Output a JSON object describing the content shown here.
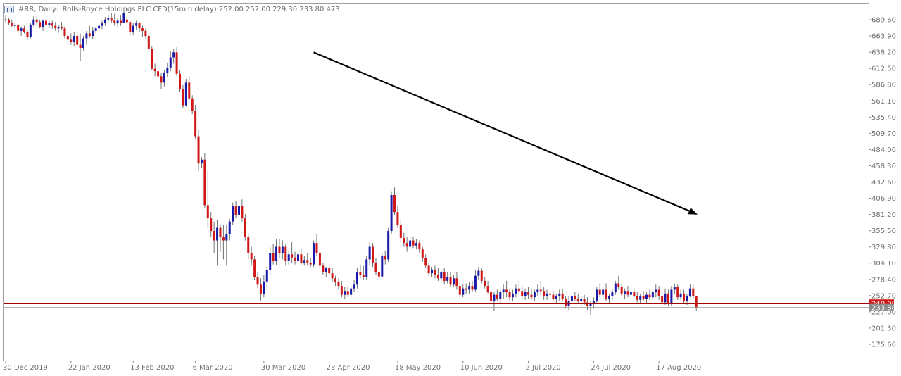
{
  "header": {
    "symbol": "#RR, Daily:",
    "name": "Rolls-Royce Holdings PLC CFD(15min delay)",
    "ohlc": "252.00 252.00 229.30 233.80",
    "volume": "473"
  },
  "colors": {
    "up": "#1a1aa8",
    "down": "#d01818",
    "level_line": "#a00000",
    "price_line": "#9a9a9a",
    "trend_arrow": "#000000",
    "grid_border": "#a0a0a0"
  },
  "chart_data": {
    "type": "candlestick",
    "y_ticks": [
      "689.60",
      "663.90",
      "638.20",
      "612.50",
      "586.80",
      "561.10",
      "535.40",
      "509.70",
      "484.00",
      "458.30",
      "432.60",
      "406.90",
      "381.20",
      "355.50",
      "329.80",
      "304.10",
      "278.40",
      "252.70",
      "227.00",
      "201.30",
      "175.60"
    ],
    "y_range": [
      149.9,
      715.3
    ],
    "x_labels": [
      "30 Dec 2019",
      "22 Jan 2020",
      "13 Feb 2020",
      "6 Mar 2020",
      "30 Mar 2020",
      "23 Apr 2020",
      "18 May 2020",
      "10 Jun 2020",
      "2 Jul 2020",
      "24 Jul 2020",
      "17 Aug 2020"
    ],
    "level_line": {
      "value": 240.0,
      "label": "240.00"
    },
    "current_price": {
      "value": 233.8,
      "label": "233.80"
    },
    "trend_arrow": {
      "from_candle": 99,
      "from_price": 638,
      "to_candle": 222,
      "to_price": 382
    },
    "candles": [
      [
        690,
        696,
        686,
        690
      ],
      [
        690,
        692,
        681,
        684
      ],
      [
        684,
        690,
        678,
        680
      ],
      [
        680,
        684,
        676,
        681
      ],
      [
        681,
        684,
        670,
        672
      ],
      [
        672,
        679,
        664,
        676
      ],
      [
        676,
        680,
        668,
        670
      ],
      [
        670,
        674,
        658,
        662
      ],
      [
        662,
        684,
        660,
        682
      ],
      [
        682,
        695,
        679,
        690
      ],
      [
        690,
        695,
        680,
        686
      ],
      [
        686,
        690,
        676,
        678
      ],
      [
        678,
        690,
        672,
        688
      ],
      [
        688,
        692,
        678,
        681
      ],
      [
        681,
        688,
        676,
        684
      ],
      [
        684,
        688,
        675,
        680
      ],
      [
        680,
        686,
        672,
        676
      ],
      [
        676,
        682,
        669,
        678
      ],
      [
        678,
        686,
        673,
        676
      ],
      [
        676,
        679,
        660,
        664
      ],
      [
        664,
        670,
        652,
        658
      ],
      [
        658,
        668,
        650,
        654
      ],
      [
        654,
        670,
        648,
        664
      ],
      [
        664,
        670,
        647,
        650
      ],
      [
        650,
        668,
        625,
        645
      ],
      [
        645,
        664,
        641,
        660
      ],
      [
        660,
        672,
        650,
        668
      ],
      [
        668,
        680,
        661,
        664
      ],
      [
        664,
        678,
        659,
        672
      ],
      [
        672,
        678,
        668,
        676
      ],
      [
        676,
        684,
        670,
        680
      ],
      [
        680,
        688,
        675,
        684
      ],
      [
        684,
        694,
        680,
        690
      ],
      [
        690,
        697,
        687,
        693
      ],
      [
        693,
        700,
        684,
        688
      ],
      [
        688,
        699,
        680,
        684
      ],
      [
        684,
        692,
        678,
        688
      ],
      [
        688,
        696,
        680,
        685
      ],
      [
        685,
        703,
        685,
        700
      ],
      [
        690,
        696,
        684,
        686
      ],
      [
        686,
        688,
        666,
        670
      ],
      [
        670,
        684,
        666,
        680
      ],
      [
        680,
        688,
        674,
        684
      ],
      [
        684,
        686,
        670,
        676
      ],
      [
        676,
        680,
        662,
        672
      ],
      [
        672,
        676,
        660,
        664
      ],
      [
        664,
        668,
        640,
        644
      ],
      [
        644,
        648,
        610,
        612
      ],
      [
        612,
        620,
        600,
        608
      ],
      [
        608,
        614,
        596,
        600
      ],
      [
        600,
        606,
        580,
        590
      ],
      [
        590,
        610,
        584,
        606
      ],
      [
        606,
        622,
        598,
        614
      ],
      [
        614,
        640,
        608,
        630
      ],
      [
        630,
        644,
        620,
        638
      ],
      [
        638,
        646,
        600,
        604
      ],
      [
        604,
        610,
        575,
        580
      ],
      [
        580,
        586,
        550,
        554
      ],
      [
        554,
        596,
        552,
        590
      ],
      [
        590,
        600,
        560,
        565
      ],
      [
        565,
        570,
        540,
        545
      ],
      [
        545,
        555,
        500,
        505
      ],
      [
        505,
        515,
        450,
        462
      ],
      [
        462,
        472,
        455,
        468
      ],
      [
        468,
        478,
        392,
        396
      ],
      [
        396,
        450,
        360,
        375
      ],
      [
        375,
        385,
        345,
        355
      ],
      [
        355,
        370,
        320,
        340
      ],
      [
        340,
        372,
        300,
        360
      ],
      [
        360,
        365,
        322,
        345
      ],
      [
        345,
        364,
        310,
        340
      ],
      [
        340,
        365,
        300,
        350
      ],
      [
        350,
        374,
        340,
        370
      ],
      [
        370,
        400,
        365,
        394
      ],
      [
        394,
        402,
        375,
        380
      ],
      [
        380,
        400,
        375,
        395
      ],
      [
        395,
        405,
        370,
        375
      ],
      [
        375,
        382,
        340,
        345
      ],
      [
        345,
        350,
        310,
        320
      ],
      [
        320,
        330,
        300,
        310
      ],
      [
        310,
        316,
        278,
        282
      ],
      [
        282,
        290,
        265,
        270
      ],
      [
        270,
        280,
        245,
        255
      ],
      [
        255,
        285,
        250,
        275
      ],
      [
        275,
        300,
        262,
        293
      ],
      [
        293,
        330,
        285,
        320
      ],
      [
        320,
        335,
        302,
        308
      ],
      [
        308,
        342,
        301,
        330
      ],
      [
        330,
        342,
        313,
        320
      ],
      [
        320,
        340,
        310,
        330
      ],
      [
        330,
        335,
        300,
        308
      ],
      [
        308,
        324,
        300,
        318
      ],
      [
        318,
        337,
        304,
        313
      ],
      [
        313,
        322,
        302,
        308
      ],
      [
        308,
        324,
        300,
        318
      ],
      [
        318,
        327,
        302,
        305
      ],
      [
        305,
        316,
        300,
        309
      ],
      [
        309,
        320,
        300,
        305
      ],
      [
        305,
        312,
        298,
        302
      ],
      [
        302,
        340,
        298,
        336
      ],
      [
        336,
        350,
        315,
        320
      ],
      [
        320,
        328,
        295,
        300
      ],
      [
        300,
        305,
        285,
        290
      ],
      [
        290,
        298,
        282,
        296
      ],
      [
        296,
        302,
        284,
        288
      ],
      [
        288,
        296,
        275,
        280
      ],
      [
        280,
        284,
        268,
        274
      ],
      [
        274,
        280,
        262,
        268
      ],
      [
        268,
        276,
        250,
        254
      ],
      [
        254,
        266,
        248,
        260
      ],
      [
        260,
        268,
        250,
        254
      ],
      [
        254,
        270,
        250,
        264
      ],
      [
        264,
        278,
        258,
        270
      ],
      [
        270,
        296,
        264,
        290
      ],
      [
        290,
        302,
        280,
        286
      ],
      [
        286,
        300,
        278,
        282
      ],
      [
        282,
        315,
        278,
        310
      ],
      [
        310,
        338,
        300,
        330
      ],
      [
        330,
        336,
        298,
        304
      ],
      [
        304,
        312,
        285,
        290
      ],
      [
        290,
        300,
        278,
        283
      ],
      [
        283,
        320,
        282,
        316
      ],
      [
        316,
        324,
        302,
        310
      ],
      [
        310,
        360,
        306,
        355
      ],
      [
        355,
        418,
        350,
        412
      ],
      [
        412,
        424,
        380,
        385
      ],
      [
        385,
        395,
        360,
        365
      ],
      [
        365,
        372,
        338,
        344
      ],
      [
        344,
        352,
        330,
        336
      ],
      [
        336,
        346,
        322,
        330
      ],
      [
        330,
        346,
        324,
        340
      ],
      [
        340,
        346,
        328,
        332
      ],
      [
        332,
        342,
        326,
        336
      ],
      [
        336,
        340,
        320,
        326
      ],
      [
        326,
        330,
        306,
        312
      ],
      [
        312,
        318,
        296,
        300
      ],
      [
        300,
        304,
        284,
        288
      ],
      [
        288,
        298,
        282,
        294
      ],
      [
        294,
        300,
        280,
        286
      ],
      [
        286,
        296,
        276,
        280
      ],
      [
        280,
        294,
        276,
        290
      ],
      [
        290,
        296,
        270,
        276
      ],
      [
        276,
        290,
        272,
        282
      ],
      [
        282,
        290,
        266,
        270
      ],
      [
        270,
        286,
        266,
        280
      ],
      [
        280,
        290,
        262,
        268
      ],
      [
        268,
        274,
        250,
        254
      ],
      [
        254,
        270,
        250,
        264
      ],
      [
        264,
        272,
        256,
        262
      ],
      [
        262,
        274,
        256,
        268
      ],
      [
        268,
        276,
        258,
        262
      ],
      [
        262,
        294,
        258,
        284
      ],
      [
        284,
        298,
        278,
        292
      ],
      [
        292,
        296,
        272,
        276
      ],
      [
        276,
        282,
        264,
        268
      ],
      [
        268,
        276,
        256,
        258
      ],
      [
        258,
        264,
        238,
        244
      ],
      [
        244,
        258,
        228,
        254
      ],
      [
        254,
        262,
        244,
        248
      ],
      [
        248,
        262,
        240,
        258
      ],
      [
        258,
        270,
        248,
        262
      ],
      [
        262,
        276,
        250,
        258
      ],
      [
        258,
        264,
        244,
        250
      ],
      [
        250,
        262,
        244,
        256
      ],
      [
        256,
        270,
        250,
        264
      ],
      [
        264,
        276,
        256,
        260
      ],
      [
        260,
        268,
        246,
        252
      ],
      [
        252,
        264,
        246,
        258
      ],
      [
        258,
        266,
        248,
        254
      ],
      [
        254,
        264,
        246,
        250
      ],
      [
        250,
        262,
        244,
        258
      ],
      [
        258,
        270,
        252,
        262
      ],
      [
        262,
        276,
        254,
        260
      ],
      [
        260,
        266,
        246,
        252
      ],
      [
        252,
        262,
        246,
        256
      ],
      [
        256,
        264,
        248,
        254
      ],
      [
        254,
        260,
        244,
        248
      ],
      [
        248,
        256,
        240,
        252
      ],
      [
        252,
        262,
        244,
        256
      ],
      [
        256,
        264,
        244,
        248
      ],
      [
        248,
        252,
        232,
        236
      ],
      [
        236,
        252,
        230,
        244
      ],
      [
        244,
        256,
        238,
        252
      ],
      [
        252,
        258,
        244,
        248
      ],
      [
        248,
        256,
        240,
        244
      ],
      [
        244,
        252,
        236,
        248
      ],
      [
        248,
        254,
        238,
        242
      ],
      [
        242,
        250,
        230,
        236
      ],
      [
        236,
        244,
        222,
        240
      ],
      [
        240,
        250,
        232,
        244
      ],
      [
        244,
        266,
        240,
        262
      ],
      [
        262,
        272,
        250,
        254
      ],
      [
        254,
        268,
        248,
        262
      ],
      [
        262,
        272,
        244,
        248
      ],
      [
        248,
        256,
        240,
        252
      ],
      [
        252,
        262,
        246,
        258
      ],
      [
        258,
        276,
        254,
        272
      ],
      [
        272,
        284,
        262,
        266
      ],
      [
        266,
        272,
        252,
        256
      ],
      [
        256,
        264,
        248,
        260
      ],
      [
        260,
        268,
        250,
        254
      ],
      [
        254,
        262,
        246,
        258
      ],
      [
        258,
        264,
        250,
        252
      ],
      [
        252,
        258,
        242,
        246
      ],
      [
        246,
        256,
        240,
        252
      ],
      [
        252,
        260,
        244,
        248
      ],
      [
        248,
        258,
        240,
        254
      ],
      [
        254,
        262,
        246,
        250
      ],
      [
        250,
        262,
        244,
        258
      ],
      [
        258,
        270,
        250,
        262
      ],
      [
        262,
        268,
        246,
        252
      ],
      [
        252,
        258,
        236,
        242
      ],
      [
        242,
        264,
        238,
        256
      ],
      [
        256,
        262,
        236,
        240
      ],
      [
        240,
        268,
        236,
        262
      ],
      [
        262,
        272,
        256,
        266
      ],
      [
        266,
        270,
        246,
        250
      ],
      [
        250,
        262,
        246,
        256
      ],
      [
        256,
        262,
        240,
        244
      ],
      [
        244,
        256,
        238,
        252
      ],
      [
        252,
        270,
        250,
        264
      ],
      [
        264,
        270,
        248,
        252
      ],
      [
        252,
        252,
        229.3,
        233.8
      ]
    ]
  }
}
